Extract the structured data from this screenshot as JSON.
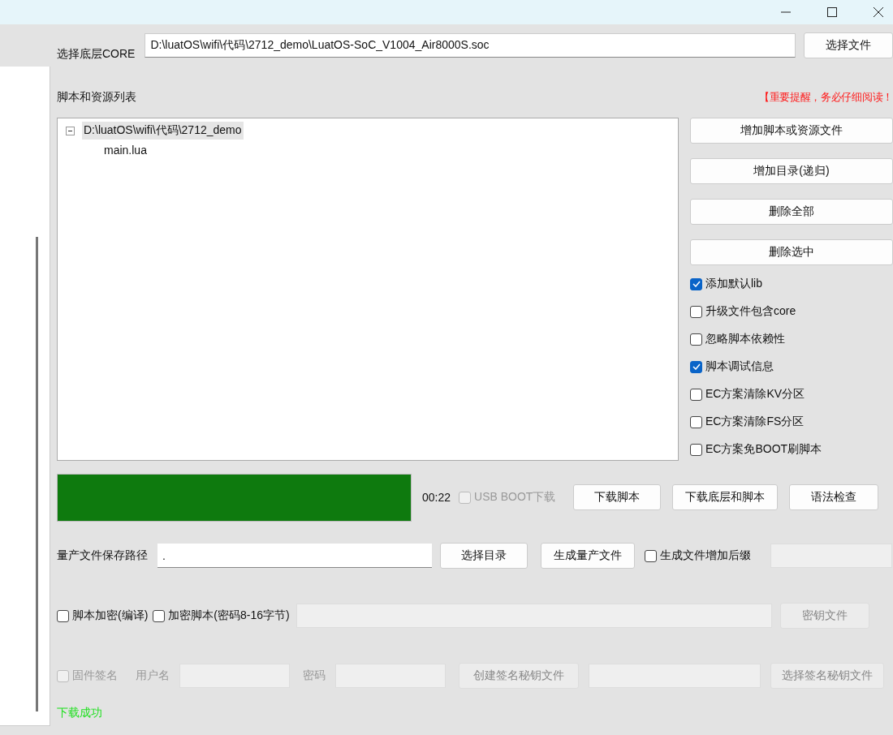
{
  "core": {
    "label": "选择底层CORE",
    "path": "D:\\luatOS\\wifi\\代码\\2712_demo\\LuatOS-SoC_V1004_Air8000S.soc",
    "button": "选择文件"
  },
  "scripts": {
    "label": "脚本和资源列表",
    "notice": "【重要提醒，务必仔细阅读！",
    "tree": [
      {
        "label": "D:\\luatOS\\wifi\\代码\\2712_demo",
        "expanded": true,
        "selected": true,
        "children": [
          {
            "label": "main.lua",
            "selected": false
          }
        ]
      }
    ],
    "buttons": [
      "增加脚本或资源文件",
      "增加目录(递归)",
      "删除全部",
      "删除选中"
    ],
    "options": [
      {
        "label": "添加默认lib",
        "checked": true
      },
      {
        "label": "升级文件包含core",
        "checked": false
      },
      {
        "label": "忽略脚本依赖性",
        "checked": false
      },
      {
        "label": "脚本调试信息",
        "checked": true
      },
      {
        "label": "EC方案清除KV分区",
        "checked": false
      },
      {
        "label": "EC方案清除FS分区",
        "checked": false
      },
      {
        "label": "EC方案免BOOT刷脚本",
        "checked": false
      }
    ]
  },
  "download": {
    "level": 1,
    "time": "00:22",
    "usb_boot": {
      "label": "USB BOOT下载",
      "checked": false,
      "disabled": true
    },
    "buttons": [
      "下载脚本",
      "下载底层和脚本",
      "语法检查"
    ]
  },
  "mass_production": {
    "label": "量产文件保存路径",
    "path": ".",
    "buttons": [
      "选择目录",
      "生成量产文件"
    ],
    "suffix": {
      "label": "生成文件增加后缀",
      "checked": false
    }
  },
  "encryption": {
    "compile": {
      "label": "脚本加密(编译)",
      "checked": false,
      "disabled": false
    },
    "encrypt": {
      "label": "加密脚本(密码8-16字节)",
      "checked": false,
      "disabled": false
    },
    "key_button": "密钥文件",
    "disabled": true
  },
  "signing": {
    "checkbox": {
      "label": "固件签名",
      "checked": false,
      "disabled": true
    },
    "username_label": "用户名",
    "password_label": "密码",
    "create_button": "创建签名秘钥文件",
    "select_button": "选择签名秘钥文件",
    "disabled": true
  },
  "status": "下载成功"
}
